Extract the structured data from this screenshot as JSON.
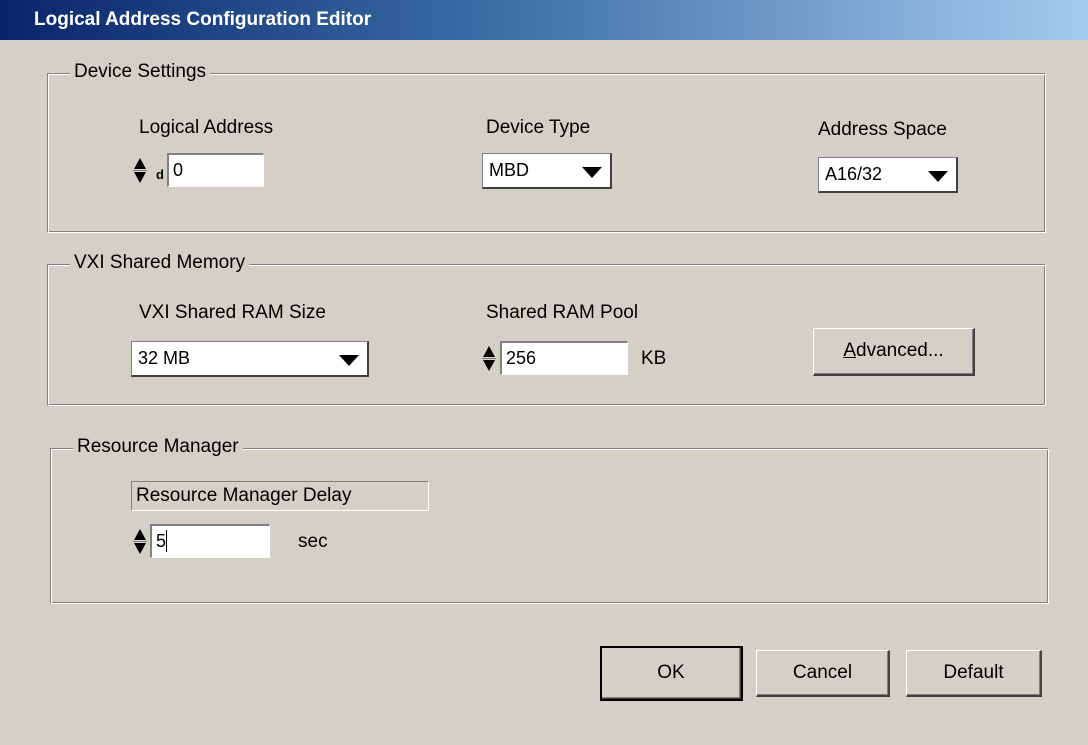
{
  "window": {
    "title": "Logical Address Configuration Editor"
  },
  "device_settings": {
    "legend": "Device Settings",
    "logical_address_label": "Logical Address",
    "logical_address_radix": "d",
    "logical_address_value": "0",
    "device_type_label": "Device Type",
    "device_type_value": "MBD",
    "address_space_label": "Address Space",
    "address_space_value": "A16/32"
  },
  "vxi_shared_memory": {
    "legend": "VXI Shared Memory",
    "ram_size_label": "VXI Shared RAM Size",
    "ram_size_value": "32 MB",
    "ram_pool_label": "Shared RAM Pool",
    "ram_pool_value": "256",
    "ram_pool_unit": "KB",
    "advanced_button": "Advanced..."
  },
  "resource_manager": {
    "legend": "Resource Manager",
    "delay_label": "Resource Manager Delay",
    "delay_value": "5",
    "delay_unit": "sec"
  },
  "buttons": {
    "ok": "OK",
    "cancel": "Cancel",
    "default": "Default"
  },
  "icons": {
    "spin": "spin-arrows-icon",
    "dropdown": "dropdown-arrow-icon"
  },
  "colors": {
    "face": "#d4d0c8",
    "title_start": "#0a246a",
    "title_end": "#a6caf0"
  }
}
